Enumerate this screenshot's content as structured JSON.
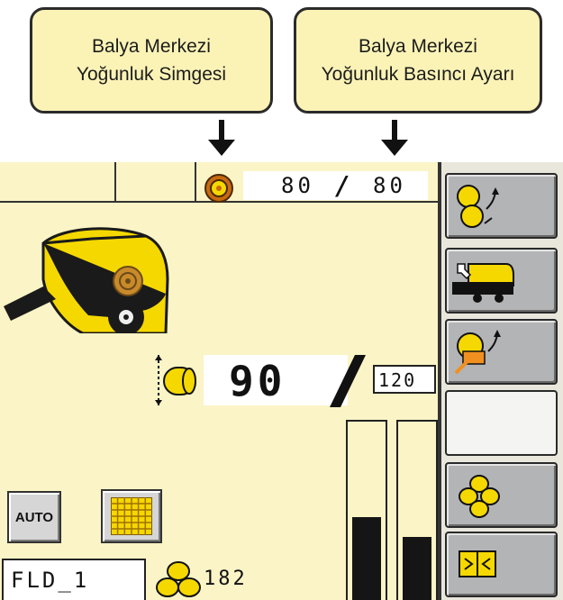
{
  "callouts": {
    "left": {
      "line1": "Balya Merkezi",
      "line2": "Yoğunluk Simgesi"
    },
    "right": {
      "line1": "Balya Merkezi",
      "line2": "Yoğunluk Basıncı Ayarı"
    }
  },
  "top_bar": {
    "current": "80",
    "separator": "/",
    "setpoint": "80"
  },
  "density": {
    "value": "90",
    "separator": "/",
    "max": "120"
  },
  "auto_label": "AUTO",
  "field_name": "FLD_1",
  "bale_count": "182",
  "bars": {
    "left_level": 0.46,
    "right_level": 0.35
  },
  "colors": {
    "accent": "#f5d800",
    "screen_bg": "#fbf4c6",
    "callout_bg": "#fbf3b6",
    "softkey": "#b3b4b6"
  },
  "softkeys": [
    "density-adjust-icon",
    "baler-settings-icon",
    "net-wrap-icon",
    "blank",
    "bale-counter-icon",
    "manual-book-icon"
  ]
}
